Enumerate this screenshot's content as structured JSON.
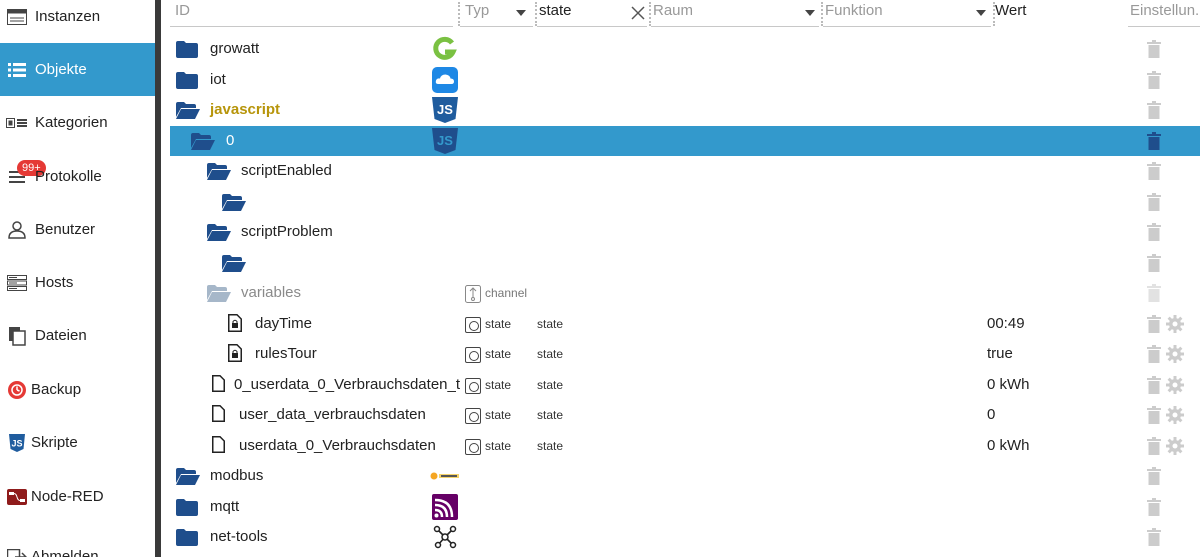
{
  "sidebar": {
    "items": [
      {
        "label": "Instanzen",
        "icon": "instances-icon"
      },
      {
        "label": "Objekte",
        "icon": "list-icon",
        "active": true
      },
      {
        "label": "Kategorien",
        "icon": "categories-icon"
      },
      {
        "label": "Protokolle",
        "icon": "log-icon",
        "badge": "99+"
      },
      {
        "label": "Benutzer",
        "icon": "user-icon"
      },
      {
        "label": "Hosts",
        "icon": "hosts-icon"
      },
      {
        "label": "Dateien",
        "icon": "files-icon"
      },
      {
        "label": "Backup",
        "icon": "backup-icon"
      },
      {
        "label": "Skripte",
        "icon": "scripts-icon"
      },
      {
        "label": "Node-RED",
        "icon": "node-red-icon"
      },
      {
        "label": "Abmelden",
        "icon": "logout-icon"
      }
    ]
  },
  "header": {
    "id_placeholder": "ID",
    "type_placeholder": "Typ",
    "role_value": "state",
    "room_placeholder": "Raum",
    "function_placeholder": "Funktion",
    "value_label": "Wert",
    "settings_label": "Einstellun..."
  },
  "rows": [
    {
      "name": "growatt",
      "icon": "growatt-icon"
    },
    {
      "name": "iot",
      "icon": "cloud-icon"
    },
    {
      "name": "javascript",
      "icon": "js-icon"
    },
    {
      "name": "0",
      "icon": "js-icon"
    },
    {
      "name": "scriptEnabled"
    },
    {
      "name": ""
    },
    {
      "name": "scriptProblem"
    },
    {
      "name": ""
    },
    {
      "name": "variables",
      "type": "channel"
    },
    {
      "name": "dayTime",
      "type": "state",
      "role": "state",
      "value": "00:49"
    },
    {
      "name": "rulesTour",
      "type": "state",
      "role": "state",
      "value": "true"
    },
    {
      "name": "0_userdata_0_Verbrauchsdaten_t",
      "type": "state",
      "role": "state",
      "value": "0 kWh"
    },
    {
      "name": "user_data_verbrauchsdaten",
      "type": "state",
      "role": "state",
      "value": "0"
    },
    {
      "name": "userdata_0_Verbrauchsdaten",
      "type": "state",
      "role": "state",
      "value": "0 kWh"
    },
    {
      "name": "modbus",
      "icon": "modbus-icon"
    },
    {
      "name": "mqtt",
      "icon": "mqtt-icon"
    },
    {
      "name": "net-tools",
      "icon": "net-tools-icon"
    }
  ],
  "colors": {
    "accent": "#3399cc",
    "folder": "#1f4e8c",
    "js_label": "#b7950b",
    "badge": "#e53935"
  }
}
